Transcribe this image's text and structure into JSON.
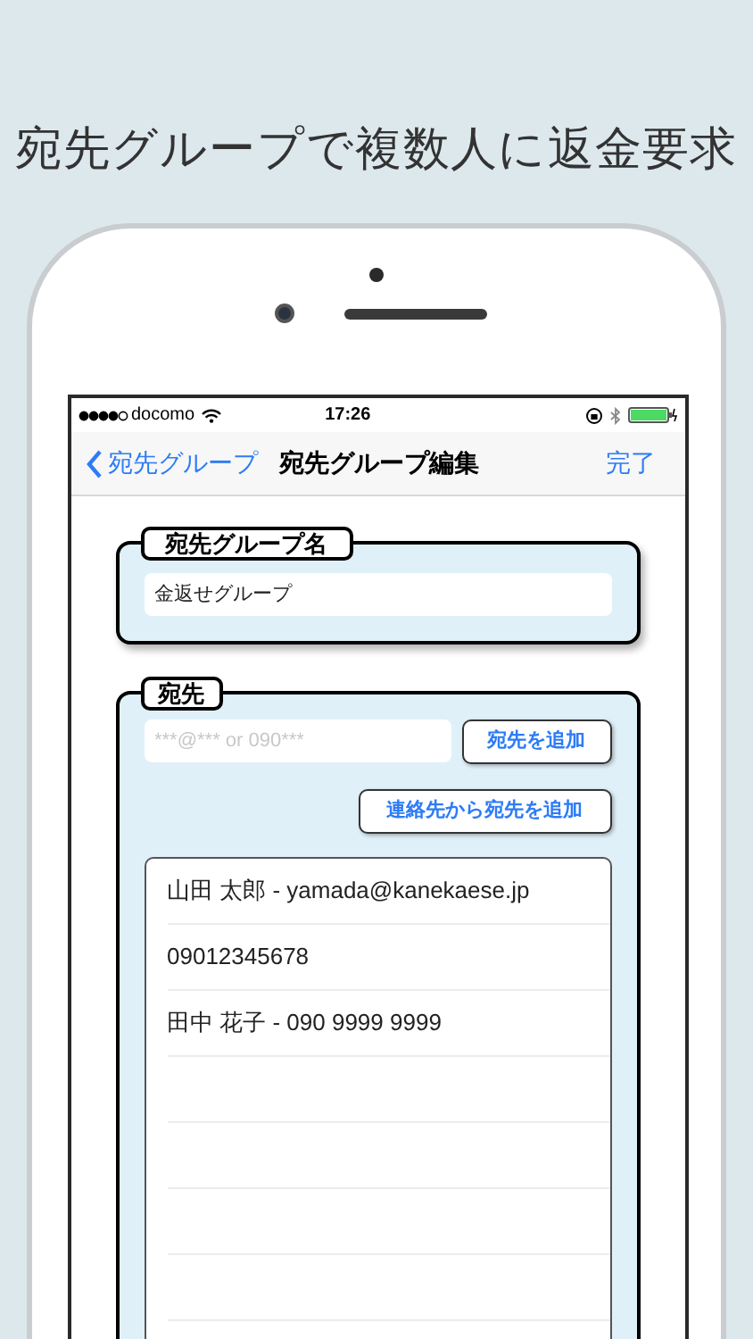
{
  "headline": "宛先グループで複数人に返金要求",
  "status_bar": {
    "carrier": "docomo",
    "time": "17:26"
  },
  "nav_bar": {
    "back": "宛先グループ",
    "title": "宛先グループ編集",
    "done": "完了"
  },
  "group_name": {
    "legend": "宛先グループ名",
    "value": "金返せグループ"
  },
  "recipients": {
    "legend": "宛先",
    "placeholder": "***@*** or 090***",
    "add_button": "宛先を追加",
    "contacts_button": "連絡先から宛先を追加",
    "rows": [
      "山田 太郎 - yamada@kanekaese.jp",
      "09012345678",
      "田中 花子 - 090 9999 9999"
    ]
  }
}
